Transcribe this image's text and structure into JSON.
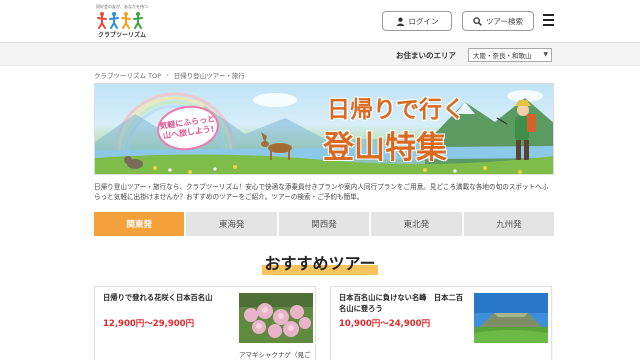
{
  "header": {
    "logo_tagline": "同好会の友が、あなたを待つ",
    "logo_text": "クラブツーリズム",
    "login_label": "ログイン",
    "search_label": "ツアー検索"
  },
  "area_bar": {
    "label": "お住まいのエリア",
    "selected": "大阪・奈良・和歌山"
  },
  "breadcrumb": [
    "クラブツーリズム TOP",
    "日帰り登山ツアー・旅行"
  ],
  "banner": {
    "title_line1": "日帰りで行く",
    "title_line2": "登山特集",
    "bubble_line1": "気軽にふらっと",
    "bubble_line2": "山へ旅しよう!"
  },
  "intro_text": "日帰り登山ツアー・旅行なら、クラブツーリズム！安心で快適な添乗員付きプランや案内人同行プランをご用意。見どころ満載な各地の旬のスポットへふらっと気軽に出掛けませんか？おすすめのツアーをご紹介。ツアーの検索・ご予約も簡単。",
  "tabs": [
    {
      "label": "関東発",
      "active": true
    },
    {
      "label": "東海発",
      "active": false
    },
    {
      "label": "関西発",
      "active": false
    },
    {
      "label": "東北発",
      "active": false
    },
    {
      "label": "九州発",
      "active": false
    }
  ],
  "section_title": "おすすめツアー",
  "cards": [
    {
      "title": "日帰りで登れる花咲く日本百名山",
      "price": "12,900円〜29,900円",
      "caption": "アマギシャクナゲ（見ご"
    },
    {
      "title": "日本百名山に負けない名峰　日本二百名山に登ろう",
      "price": "10,900円〜24,900円",
      "caption": ""
    }
  ],
  "colors": {
    "accent": "#f3a13b",
    "price": "#e0272a",
    "banner_title": "#d96a21"
  }
}
